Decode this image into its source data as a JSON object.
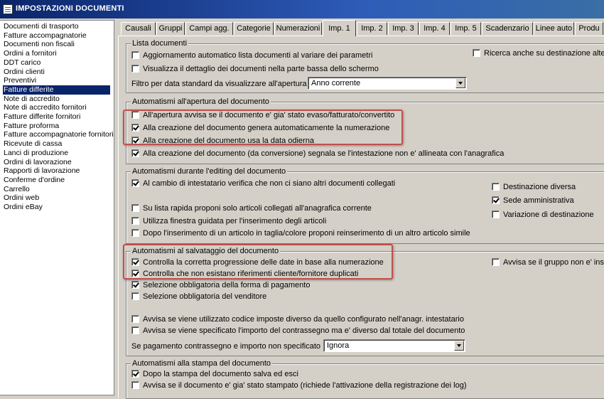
{
  "window": {
    "title": "IMPOSTAZIONI DOCUMENTI"
  },
  "document_types": [
    "Documenti di trasporto",
    "Fatture accompagnatorie",
    "Documenti non fiscali",
    "Ordini a fornitori",
    "DDT carico",
    "Ordini clienti",
    "Preventivi",
    "Fatture differite",
    "Note di accredito",
    "Note di accredito fornitori",
    "Fatture differite fornitori",
    "Fatture proforma",
    "Fatture accompagnatorie fornitori",
    "Ricevute di cassa",
    "Lanci di produzione",
    "Ordini di lavorazione",
    "Rapporti di lavorazione",
    "Conferme d'ordine",
    "Carrello",
    "Ordini web",
    "Ordini eBay"
  ],
  "selected_document_type": "Fatture differite",
  "tabs": [
    "Causali",
    "Gruppi",
    "Campi agg.",
    "Categorie",
    "Numerazioni",
    "Imp. 1",
    "Imp. 2",
    "Imp. 3",
    "Imp. 4",
    "Imp. 5",
    "Scadenzario",
    "Linee auto",
    "Produ"
  ],
  "active_tab": "Imp. 1",
  "lista": {
    "title": "Lista documenti",
    "aggiornamento": {
      "label": "Aggiornamento automatico lista documenti al variare dei parametri",
      "checked": false
    },
    "visualizza": {
      "label": "Visualizza il dettaglio dei documenti nella parte bassa dello schermo",
      "checked": false
    },
    "ricerca": {
      "label": "Ricerca anche su destinazione alter",
      "checked": false
    },
    "filter_label": "Filtro per data standard da visualizzare all'apertura :",
    "filter_value": "Anno corrente"
  },
  "apertura": {
    "title": "Automatismi all'apertura del documento",
    "items": [
      {
        "label": "All'apertura avvisa se il documento e' gia' stato evaso/fatturato/convertito",
        "checked": false
      },
      {
        "label": "Alla creazione del documento genera automaticamente la numerazione",
        "checked": true
      },
      {
        "label": "Alla creazione del documento usa la data odierna",
        "checked": true
      },
      {
        "label": "Alla creazione del documento (da conversione) segnala se l'intestazione non e' allineata con l'anagrafica",
        "checked": true
      }
    ]
  },
  "editing": {
    "title": "Automatismi durante l'editing del documento",
    "items": [
      {
        "label": "Al cambio di intestatario verifica che non ci siano altri documenti collegati",
        "checked": true
      },
      {
        "label": "Su lista rapida proponi solo articoli collegati all'anagrafica corrente",
        "checked": false
      },
      {
        "label": "Utilizza finestra guidata per l'inserimento degli articoli",
        "checked": false
      },
      {
        "label": "Dopo l'inserimento di un articolo in taglia/colore proponi reinserimento di un altro articolo simile",
        "checked": false
      }
    ],
    "right": [
      {
        "label": "Destinazione diversa",
        "checked": false
      },
      {
        "label": "Sede amministrativa",
        "checked": true
      },
      {
        "label": "Variazione di destinazione",
        "checked": false
      }
    ]
  },
  "salvataggio": {
    "title": "Automatismi al salvataggio del documento",
    "items": [
      {
        "label": "Controlla la corretta progressione delle date in base alla numerazione",
        "checked": true
      },
      {
        "label": "Controlla che non esistano riferimenti cliente/fornitore duplicati",
        "checked": true
      },
      {
        "label": "Selezione obbligatoria della forma di pagamento",
        "checked": true
      },
      {
        "label": "Selezione obbligatoria del venditore",
        "checked": false
      },
      {
        "label": "Avvisa se viene utilizzato codice imposte diverso da quello configurato nell'anagr. intestatario",
        "checked": false
      },
      {
        "label": "Avvisa se viene specificato l'importo del contrassegno ma e' diverso dal totale del documento",
        "checked": false
      }
    ],
    "avvisa_gruppo": {
      "label": "Avvisa se il gruppo non e' inse",
      "checked": false
    },
    "contrassegno_label": "Se pagamento contrassegno e importo non specificato :",
    "contrassegno_value": "Ignora"
  },
  "stampa": {
    "title": "Automatismi alla stampa del documento",
    "items": [
      {
        "label": "Dopo la stampa del documento salva ed esci",
        "checked": true
      },
      {
        "label": "Avvisa se il documento e' gia' stato stampato (richiede l'attivazione della registrazione dei log)",
        "checked": false
      }
    ]
  },
  "annotation_color": "#c0504d"
}
